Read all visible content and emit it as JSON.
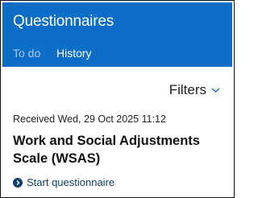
{
  "header": {
    "title": "Questionnaires"
  },
  "tabs": [
    {
      "label": "To do"
    },
    {
      "label": "History"
    }
  ],
  "filters": {
    "label": "Filters"
  },
  "item": {
    "received": "Received Wed, 29 Oct 2025 11:12",
    "title": "Work and Social Adjustments Scale (WSAS)",
    "action": "Start questionnaire"
  },
  "colors": {
    "header_bg": "#0d6ec8",
    "link": "#0f3f6e"
  },
  "icons": [
    "chevron-down-icon",
    "arrow-circle-right-icon"
  ]
}
